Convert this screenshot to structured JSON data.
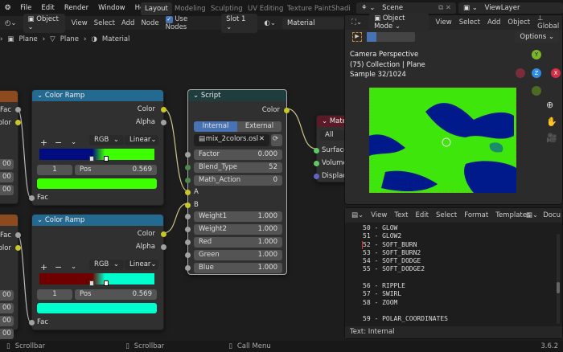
{
  "topbar": {
    "menus": [
      "File",
      "Edit",
      "Render",
      "Window",
      "Help"
    ],
    "workspaces": [
      "Layout",
      "Modeling",
      "Sculpting",
      "UV Editing",
      "Texture Paint",
      "Shadi"
    ],
    "scene": "Scene",
    "view_layer": "ViewLayer"
  },
  "node_header": {
    "mode": "Object",
    "menus": [
      "View",
      "Select",
      "Add",
      "Node"
    ],
    "use_nodes": "Use Nodes",
    "slot": "Slot 1",
    "material": "Material"
  },
  "breadcrumb": [
    "Plane",
    "Plane",
    "Material"
  ],
  "partial_node": {
    "outputs": [
      "Fac",
      "Color"
    ],
    "values": [
      "00",
      "00",
      "00",
      "00"
    ]
  },
  "color_ramps": [
    {
      "title": "Color Ramp",
      "outputs": [
        "Color",
        "Alpha"
      ],
      "mode": "RGB",
      "interp": "Linear",
      "index": "1",
      "pos_label": "Pos",
      "pos": "0.569",
      "input": "Fac",
      "color_a": "#000c80",
      "color_b": "#3cff00"
    },
    {
      "title": "Color Ramp",
      "outputs": [
        "Color",
        "Alpha"
      ],
      "mode": "RGB",
      "interp": "Linear",
      "index": "1",
      "pos_label": "Pos",
      "pos": "0.569",
      "input": "Fac",
      "color_a": "#6e0000",
      "color_b": "#00ffcc"
    }
  ],
  "script_node": {
    "title": "Script",
    "output": "Color",
    "tabs": [
      "Internal",
      "External"
    ],
    "file": "mix_2colors.osl",
    "fields": [
      {
        "label": "Factor",
        "value": "0.000"
      },
      {
        "label": "Blend_Type",
        "value": "52"
      },
      {
        "label": "Math_Action",
        "value": "0"
      }
    ],
    "inputs": [
      "A",
      "B"
    ],
    "weights": [
      {
        "label": "Weight1",
        "value": "1.000"
      },
      {
        "label": "Weight2",
        "value": "1.000"
      },
      {
        "label": "Red",
        "value": "1.000"
      },
      {
        "label": "Green",
        "value": "1.000"
      },
      {
        "label": "Blue",
        "value": "1.000"
      }
    ]
  },
  "material_output": {
    "title": "Mate",
    "target": "All",
    "inputs": [
      "Surface",
      "Volume",
      "Displace"
    ]
  },
  "viewport": {
    "mode": "Object Mode",
    "menus": [
      "View",
      "Select",
      "Add",
      "Object"
    ],
    "orientation": "Global",
    "options": "Options",
    "info": [
      "Camera Perspective",
      "(75) Collection | Plane",
      "Sample 32/1024"
    ],
    "axes": [
      "Y",
      "Z",
      "X"
    ]
  },
  "text_editor": {
    "menus": [
      "View",
      "Text",
      "Edit",
      "Select",
      "Format",
      "Templates"
    ],
    "doc": "Docu",
    "lines": [
      "50 - GLOW",
      "51 - GLOW2",
      "52 - SOFT_BURN",
      "53 - SOFT_BURN2",
      "54 - SOFT_DODGE",
      "55 - SOFT_DODGE2",
      "",
      "56 - RIPPLE",
      "57 - SWIRL",
      "58 - ZOOM",
      "",
      "59 - POLAR_COORDINATES"
    ],
    "footer": "Text: Internal"
  },
  "statusbar": {
    "items": [
      "Scrollbar",
      "Scrollbar",
      "Call Menu"
    ],
    "version": "3.6.2"
  }
}
